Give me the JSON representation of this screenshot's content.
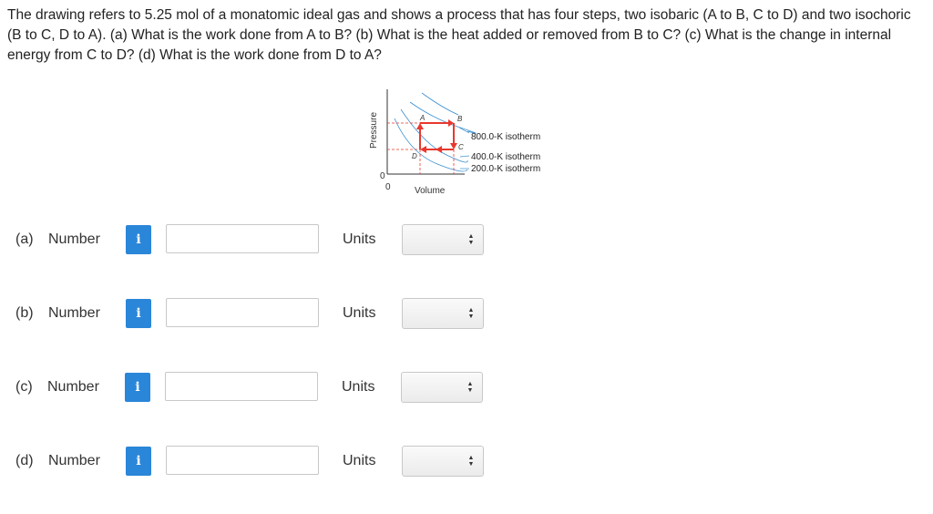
{
  "question": "The drawing refers to 5.25 mol of a monatomic ideal gas and shows a process that has four steps, two isobaric (A to B, C to D) and two isochoric (B to C, D to A). (a) What is the work done from A to B? (b) What is the heat added or removed from B to C? (c) What is the change in internal energy from C to D? (d) What is the work done from D to A?",
  "diagram": {
    "y_axis_label": "Pressure",
    "x_axis_label": "Volume",
    "origin_x": "0",
    "origin_y": "0",
    "points": {
      "a": "A",
      "b": "B",
      "c": "C",
      "d": "D"
    },
    "isotherms": [
      "800.0-K isotherm",
      "400.0-K isotherm",
      "200.0-K isotherm"
    ],
    "colors": {
      "process": "#e8382e",
      "isotherm": "#3a8fd0",
      "dashed": "#e8382e"
    }
  },
  "answers": [
    {
      "part": "(a)",
      "number_label": "Number",
      "info": "i",
      "value": "",
      "units_label": "Units",
      "units_value": ""
    },
    {
      "part": "(b)",
      "number_label": "Number",
      "info": "i",
      "value": "",
      "units_label": "Units",
      "units_value": ""
    },
    {
      "part": "(c)",
      "number_label": "Number",
      "info": "i",
      "value": "",
      "units_label": "Units",
      "units_value": ""
    },
    {
      "part": "(d)",
      "number_label": "Number",
      "info": "i",
      "value": "",
      "units_label": "Units",
      "units_value": ""
    }
  ],
  "colors": {
    "info_button": "#2a86d8"
  }
}
